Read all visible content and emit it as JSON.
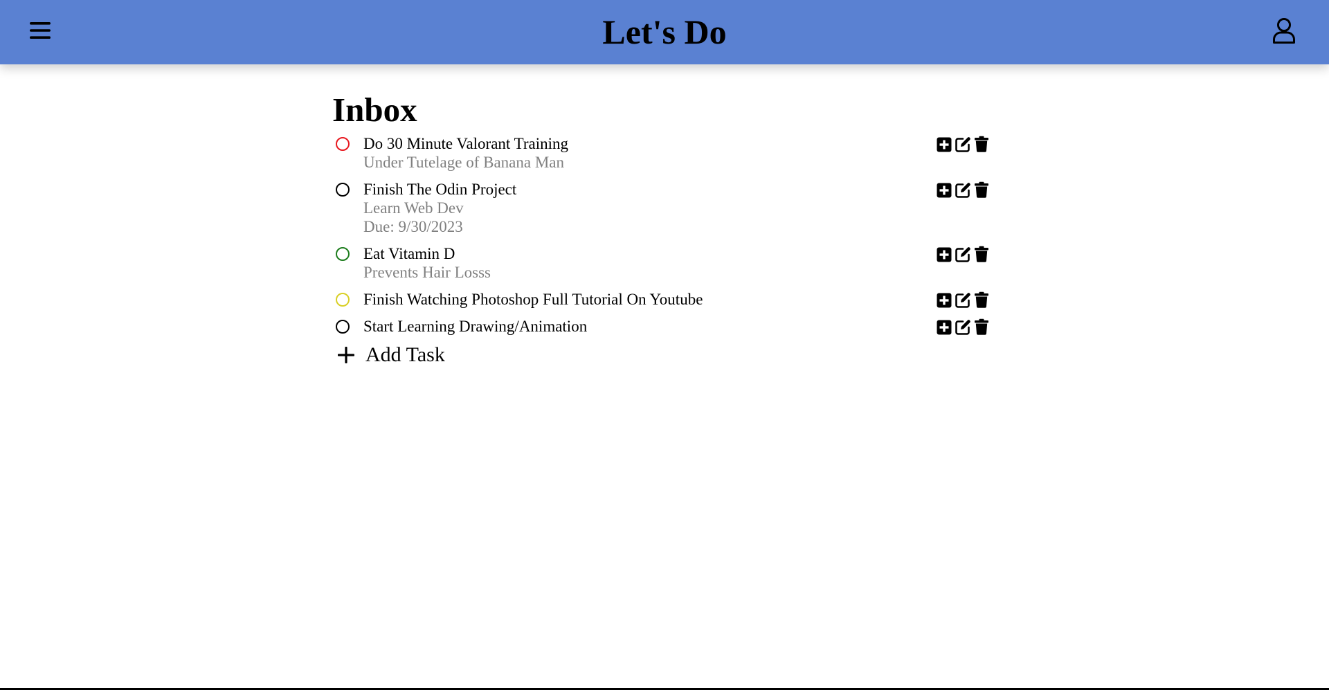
{
  "app": {
    "title": "Let's Do"
  },
  "header": {
    "menu_icon": "hamburger-menu-icon",
    "user_icon": "user-profile-icon",
    "background_color": "#5a81d2"
  },
  "main": {
    "title": "Inbox",
    "tasks": [
      {
        "title": "Do 30 Minute Valorant Training",
        "description": "Under Tutelage of Banana Man",
        "due": "",
        "priority_color": "#e8181f"
      },
      {
        "title": "Finish The Odin Project",
        "description": "Learn Web Dev",
        "due": "Due: 9/30/2023",
        "priority_color": "#000000"
      },
      {
        "title": "Eat Vitamin D",
        "description": "Prevents Hair Losss",
        "due": "",
        "priority_color": "#1e7d1e"
      },
      {
        "title": "Finish Watching Photoshop Full Tutorial On Youtube",
        "description": "",
        "due": "",
        "priority_color": "#d9cf26"
      },
      {
        "title": "Start Learning Drawing/Animation",
        "description": "",
        "due": "",
        "priority_color": "#000000"
      }
    ],
    "task_action_icons": [
      "plus-square-icon",
      "edit-icon",
      "trash-icon"
    ],
    "add_task_label": "Add Task"
  }
}
